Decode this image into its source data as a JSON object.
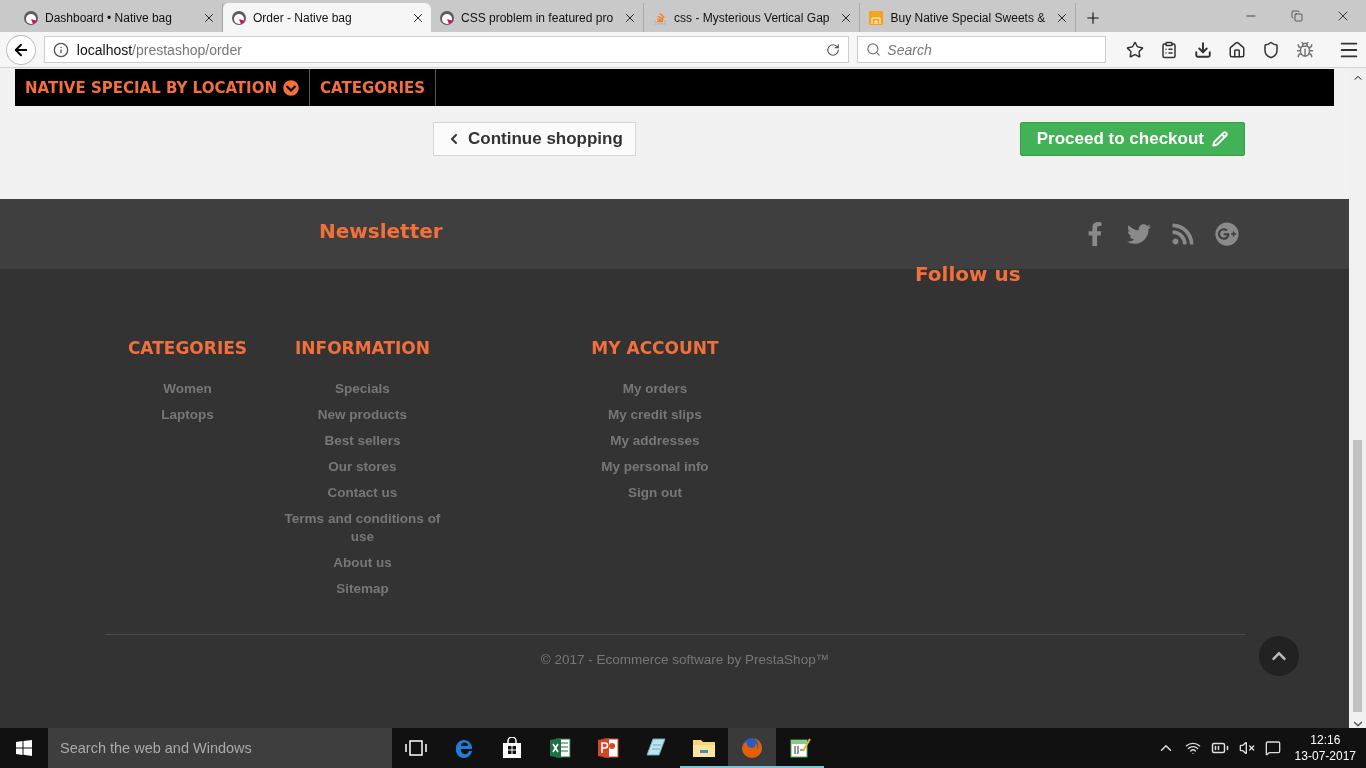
{
  "browser": {
    "tabs": [
      {
        "title": "Dashboard • Native bag",
        "kind": "prestashop",
        "selected": false
      },
      {
        "title": "Order - Native bag",
        "kind": "prestashop",
        "selected": true
      },
      {
        "title": "CSS problem in featured pro",
        "kind": "prestashop",
        "selected": false
      },
      {
        "title": "css - Mysterious Vertical Gap",
        "kind": "stack",
        "selected": false
      },
      {
        "title": "Buy Native Special Sweets &",
        "kind": "shop",
        "selected": false
      }
    ],
    "address": {
      "host": "localhost",
      "path": "/prestashop/order"
    },
    "search": {
      "placeholder": "Search"
    }
  },
  "menu": [
    {
      "label": "NATIVE SPECIAL BY LOCATION",
      "dropdown": true
    },
    {
      "label": "CATEGORIES",
      "dropdown": false
    }
  ],
  "cart_actions": {
    "continue": "Continue shopping",
    "proceed": "Proceed to checkout"
  },
  "newsletter": {
    "title": "Newsletter"
  },
  "follow": {
    "title": "Follow us"
  },
  "footer_columns": [
    {
      "title": "CATEGORIES",
      "links": [
        "Women",
        "Laptops"
      ]
    },
    {
      "title": "INFORMATION",
      "links": [
        "Specials",
        "New products",
        "Best sellers",
        "Our stores",
        "Contact us",
        "Terms and conditions of use",
        "About us",
        "Sitemap"
      ]
    },
    {
      "title": "MY ACCOUNT",
      "links": [
        "My orders",
        "My credit slips",
        "My addresses",
        "My personal info",
        "Sign out"
      ]
    }
  ],
  "copyright": "© 2017 - Ecommerce software by PrestaShop™",
  "taskbar": {
    "search": {
      "placeholder": "Search the web and Windows"
    },
    "apps": [
      {
        "kind": "taskview",
        "running": false,
        "selected": false
      },
      {
        "kind": "edge",
        "running": false,
        "selected": false
      },
      {
        "kind": "store",
        "running": false,
        "selected": false
      },
      {
        "kind": "excel",
        "running": false,
        "selected": false
      },
      {
        "kind": "powerpoint",
        "running": false,
        "selected": false
      },
      {
        "kind": "notes",
        "running": false,
        "selected": false
      },
      {
        "kind": "explorer",
        "running": true,
        "selected": false
      },
      {
        "kind": "firefox",
        "running": true,
        "selected": true
      },
      {
        "kind": "editor",
        "running": true,
        "selected": false
      }
    ],
    "time": "12:16",
    "date": "13-07-2017"
  }
}
